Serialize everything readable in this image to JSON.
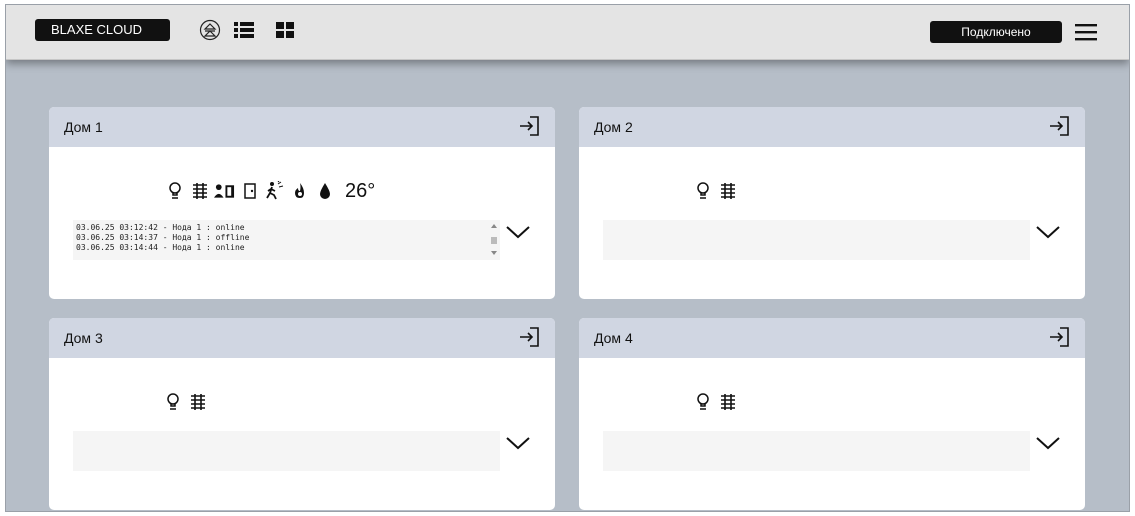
{
  "app": {
    "brand": "BLAXE CLOUD",
    "status": "Подключено"
  },
  "toolbar_icons": [
    "eject-circle-icon",
    "list-view-icon",
    "grid-view-icon",
    "hamburger-menu-icon"
  ],
  "houses": [
    {
      "title": "Дом 1",
      "temperature": "26°",
      "icons": [
        "lightbulb-icon",
        "radiator-icon",
        "presence-icon",
        "door-icon",
        "motion-icon",
        "fire-icon",
        "water-drop-icon"
      ],
      "log": [
        "03.06.25 03:12:42 - Нода 1 : online",
        "03.06.25 03:14:37 - Нода 1 : offline",
        "03.06.25 03:14:44 - Нода 1 : online"
      ]
    },
    {
      "title": "Дом 2",
      "icons": [
        "lightbulb-icon",
        "radiator-icon"
      ],
      "log": []
    },
    {
      "title": "Дом 3",
      "icons": [
        "lightbulb-icon",
        "radiator-icon"
      ],
      "log": []
    },
    {
      "title": "Дом 4",
      "icons": [
        "lightbulb-icon",
        "radiator-icon"
      ],
      "log": []
    }
  ]
}
